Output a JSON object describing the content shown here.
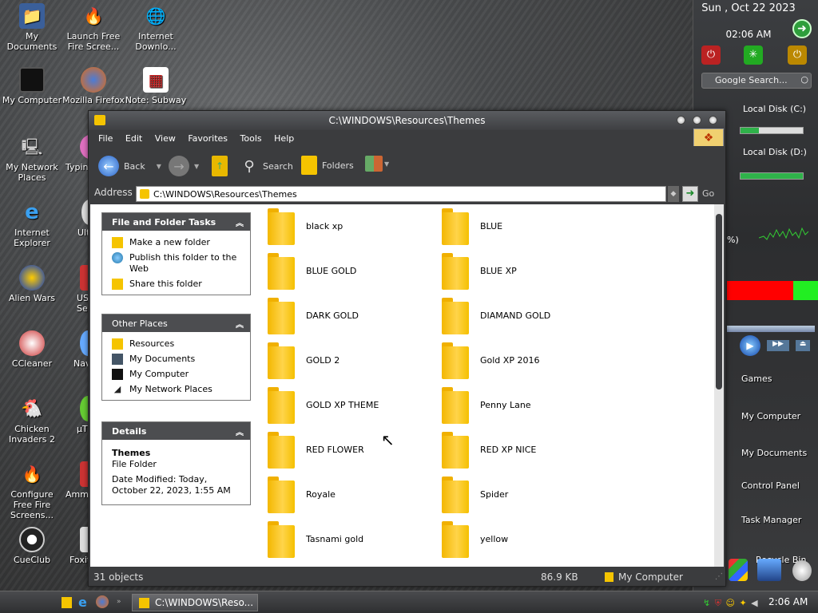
{
  "desktop": {
    "icons": [
      {
        "label": "My Documents",
        "icon": "my-documents-icon"
      },
      {
        "label": "Launch Free Fire Scree...",
        "icon": "flame-icon"
      },
      {
        "label": "Internet Downlo...",
        "icon": "download-globe-icon"
      },
      {
        "label": "My Computer",
        "icon": "monitor-icon"
      },
      {
        "label": "Mozilla Firefox",
        "icon": "firefox-icon"
      },
      {
        "label": "Note: Subway",
        "icon": "document-icon"
      },
      {
        "label": "My Network Places",
        "icon": "network-icon"
      },
      {
        "label": "Typin",
        "icon": "typing-icon"
      },
      {
        "label": "Internet Explorer",
        "icon": "ie-icon"
      },
      {
        "label": "Ult",
        "icon": "app-icon"
      },
      {
        "label": "Alien Wars",
        "icon": "alien-wars-icon"
      },
      {
        "label": "US Se",
        "icon": "app-icon"
      },
      {
        "label": "CCleaner",
        "icon": "ccleaner-icon"
      },
      {
        "label": "Navi",
        "icon": "app-icon"
      },
      {
        "label": "Chicken Invaders 2",
        "icon": "chicken-icon"
      },
      {
        "label": "µT",
        "icon": "utorrent-icon"
      },
      {
        "label": "Configure Free Fire Screens...",
        "icon": "flame-icon"
      },
      {
        "label": "Ammy",
        "icon": "app-icon"
      },
      {
        "label": "CueClub",
        "icon": "cueclub-icon"
      },
      {
        "label": "Foxit",
        "icon": "foxit-icon"
      }
    ]
  },
  "sidebar": {
    "date": "Sun , Oct 22 2023",
    "time": "02:06 AM",
    "search_placeholder": "Google Search...",
    "disks": [
      {
        "label": "Local Disk (C:)",
        "used": 0.3
      },
      {
        "label": "Local Disk (D:)",
        "used": 1.0
      }
    ],
    "cpu_percent": "%)",
    "links": [
      "Games",
      "My Computer",
      "My Documents",
      "Control Panel",
      "Task Manager",
      "Recycle Bin"
    ]
  },
  "window": {
    "title": "C:\\WINDOWS\\Resources\\Themes",
    "menu": [
      "File",
      "Edit",
      "View",
      "Favorites",
      "Tools",
      "Help"
    ],
    "toolbar": {
      "back": "Back",
      "search": "Search",
      "folders": "Folders"
    },
    "address": {
      "label": "Address",
      "value": "C:\\WINDOWS\\Resources\\Themes",
      "go": "Go"
    },
    "tasks": {
      "title": "File and Folder Tasks",
      "items": [
        "Make a new folder",
        "Publish this folder to the Web",
        "Share this folder"
      ]
    },
    "other_places": {
      "title": "Other Places",
      "items": [
        "Resources",
        "My Documents",
        "My Computer",
        "My Network Places"
      ]
    },
    "details": {
      "title": "Details",
      "name": "Themes",
      "type": "File Folder",
      "modified": "Date Modified: Today, October 22, 2023, 1:55 AM"
    },
    "folders": [
      "black xp",
      "BLUE",
      "BLUE GOLD",
      "BLUE XP",
      "DARK GOLD",
      "DIAMAND GOLD",
      "GOLD 2",
      "Gold XP 2016",
      "GOLD XP THEME",
      "Penny Lane",
      "RED FLOWER",
      "RED XP NICE",
      "Royale",
      "Spider",
      "Tasnami gold",
      "yellow"
    ],
    "status": {
      "count": "31 objects",
      "size": "86.9 KB",
      "location": "My Computer"
    }
  },
  "taskbar": {
    "active_item": "C:\\WINDOWS\\Reso...",
    "clock": "2:06 AM"
  },
  "colors": {
    "window": "#3b3c3e",
    "folder": "#f5c400",
    "accent_green": "#2fb24a"
  }
}
